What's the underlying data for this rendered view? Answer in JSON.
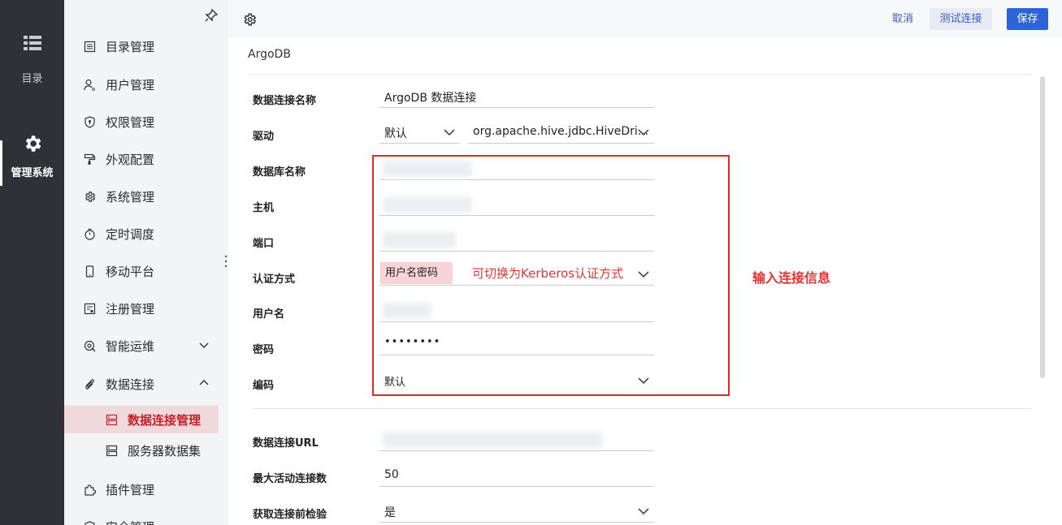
{
  "rail": {
    "catalog_label": "目录",
    "admin_label": "管理系统"
  },
  "subnav": {
    "items": [
      {
        "label": "目录管理",
        "icon": "list-icon"
      },
      {
        "label": "用户管理",
        "icon": "user-list-icon"
      },
      {
        "label": "权限管理",
        "icon": "shield-icon"
      },
      {
        "label": "外观配置",
        "icon": "paint-roller-icon"
      },
      {
        "label": "系统管理",
        "icon": "gear-icon"
      },
      {
        "label": "定时调度",
        "icon": "timer-icon"
      },
      {
        "label": "移动平台",
        "icon": "mobile-icon"
      },
      {
        "label": "注册管理",
        "icon": "register-icon"
      },
      {
        "label": "智能运维",
        "icon": "ops-icon"
      },
      {
        "label": "数据连接",
        "icon": "paperclip-icon"
      },
      {
        "label": "数据连接管理",
        "icon": "server-icon"
      },
      {
        "label": "服务器数据集",
        "icon": "server-icon"
      },
      {
        "label": "插件管理",
        "icon": "puzzle-icon"
      },
      {
        "label": "安全管理",
        "icon": "shield-icon"
      }
    ]
  },
  "toolbar": {
    "cancel": "取消",
    "test": "测试连接",
    "save": "保存"
  },
  "main": {
    "db_title": "ArgoDB"
  },
  "form": {
    "labels": {
      "conn_name": "数据连接名称",
      "driver": "驱动",
      "db_name": "数据库名称",
      "host": "主机",
      "port": "端口",
      "auth": "认证方式",
      "username": "用户名",
      "password": "密码",
      "encoding": "编码",
      "url": "数据连接URL",
      "max_active": "最大活动连接数",
      "validate": "获取连接前检验"
    },
    "values": {
      "conn_name": "ArgoDB 数据连接",
      "driver_mode": "默认",
      "driver_class": "org.apache.hive.jdbc.HiveDri...",
      "auth": "用户名密码",
      "password": "••••••••",
      "encoding": "默认",
      "max_active": "50",
      "validate": "是"
    }
  },
  "annotations": {
    "kerberos_hint": "可切换为Kerberos认证方式",
    "input_info": "输入连接信息"
  },
  "colors": {
    "accent": "#2c63d6",
    "annotation_red": "#e43535",
    "selected_bg": "#f0d9db",
    "selected_text": "#c4222b",
    "rail_bg": "#2f3134"
  }
}
